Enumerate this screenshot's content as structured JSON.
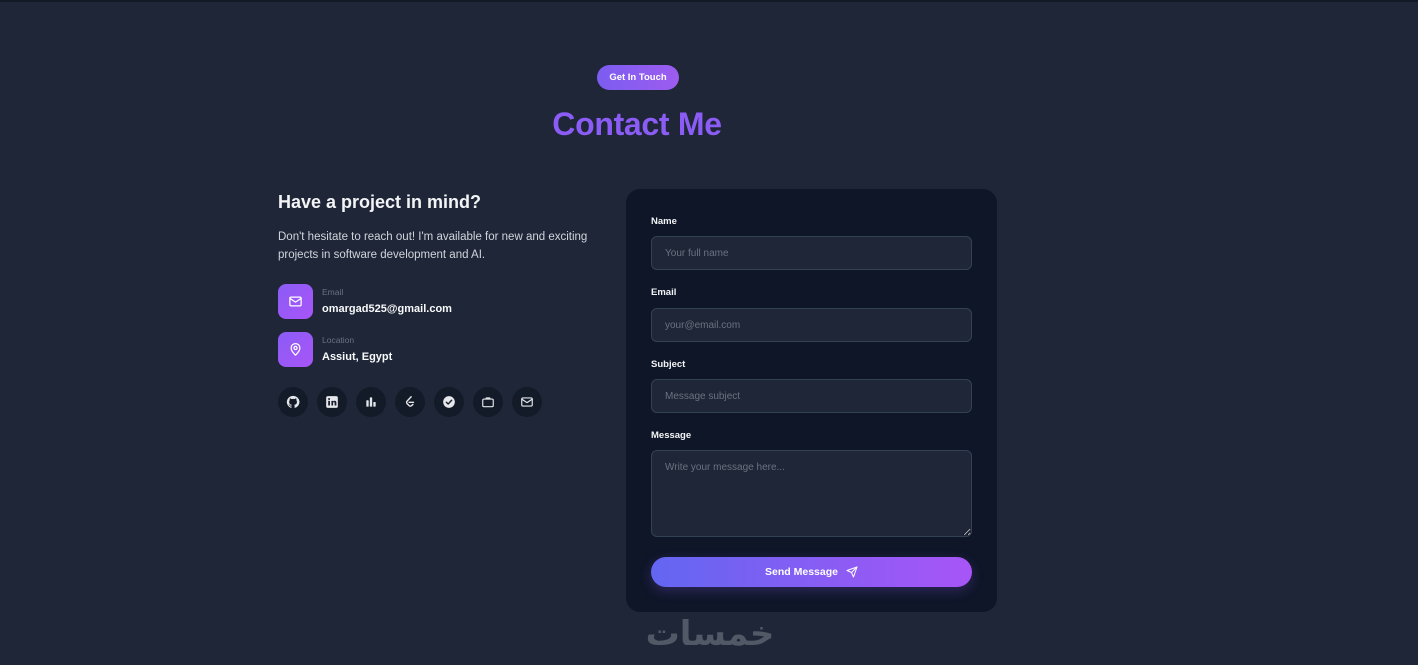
{
  "header": {
    "badge": "Get In Touch",
    "title": "Contact Me"
  },
  "intro": {
    "heading": "Have a project in mind?",
    "description": "Don't hesitate to reach out! I'm available for new and exciting projects in software development and AI."
  },
  "contact_info": [
    {
      "label": "Email",
      "value": "omargad525@gmail.com",
      "icon": "mail-icon"
    },
    {
      "label": "Location",
      "value": "Assiut, Egypt",
      "icon": "map-pin-icon"
    }
  ],
  "socials": [
    "github-icon",
    "linkedin-icon",
    "bar-chart-icon",
    "leetcode-icon",
    "check-circle-icon",
    "briefcase-icon",
    "mail-icon"
  ],
  "form": {
    "name_label": "Name",
    "name_placeholder": "Your full name",
    "email_label": "Email",
    "email_placeholder": "your@email.com",
    "subject_label": "Subject",
    "subject_placeholder": "Message subject",
    "message_label": "Message",
    "message_placeholder": "Write your message here...",
    "submit_label": "Send Message",
    "submit_icon": "send-icon"
  },
  "watermark": "خمسات",
  "colors": {
    "background": "#1e2638",
    "card": "#0f1628",
    "accent": "#8b5cf6",
    "accent_gradient_end": "#a855f7"
  }
}
